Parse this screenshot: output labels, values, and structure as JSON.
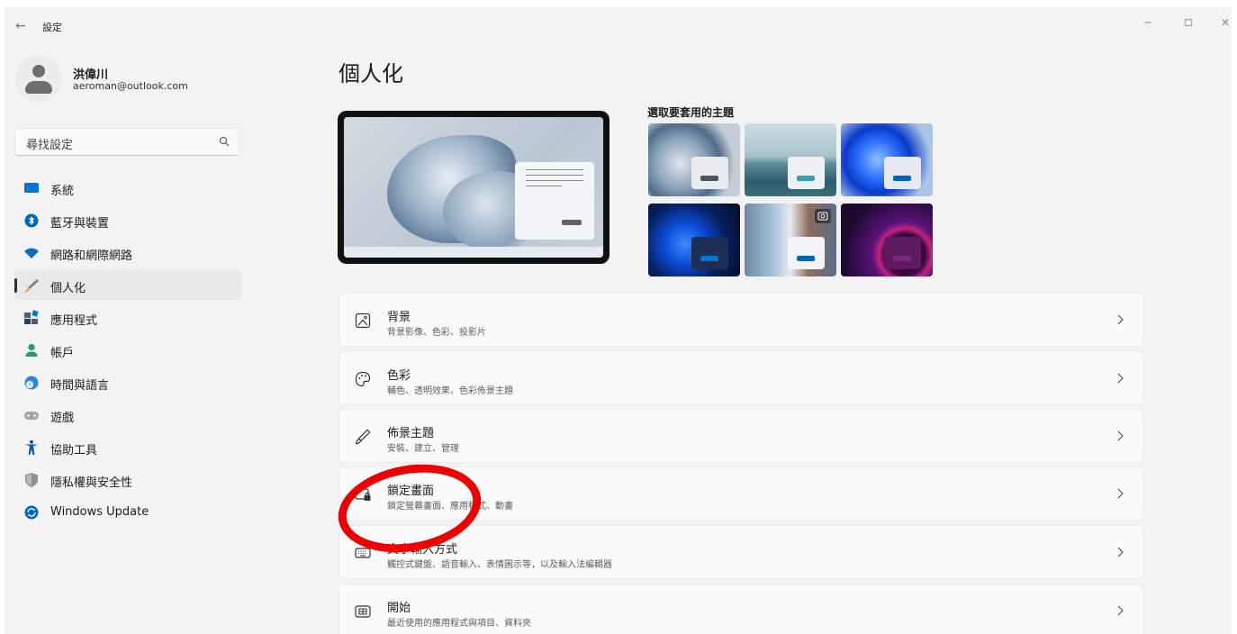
{
  "window": {
    "title": "設定",
    "back": "←",
    "minimize": "─",
    "close": "✕"
  },
  "user": {
    "name": "洪偉川",
    "email": "aeroman@outlook.com"
  },
  "search": {
    "placeholder": "尋找設定"
  },
  "nav": [
    {
      "label": "系統",
      "icon": "monitor-icon",
      "color": "#0078d4"
    },
    {
      "label": "藍牙與裝置",
      "icon": "bluetooth-icon",
      "color": "#0067c0"
    },
    {
      "label": "網路和網際網路",
      "icon": "wifi-icon",
      "color": "#0f6cbd"
    },
    {
      "label": "個人化",
      "icon": "brush-icon",
      "color": "#e8a33d",
      "active": true
    },
    {
      "label": "應用程式",
      "icon": "apps-icon",
      "color": "#4a5e75"
    },
    {
      "label": "帳戶",
      "icon": "person-icon",
      "color": "#1f9e6f"
    },
    {
      "label": "時間與語言",
      "icon": "globe-clock-icon",
      "color": "#2b88d8"
    },
    {
      "label": "遊戲",
      "icon": "gamepad-icon",
      "color": "#7a8a9a"
    },
    {
      "label": "協助工具",
      "icon": "accessibility-icon",
      "color": "#0b5cad"
    },
    {
      "label": "隱私權與安全性",
      "icon": "shield-icon",
      "color": "#8a8f98"
    },
    {
      "label": "Windows Update",
      "icon": "update-icon",
      "color": "#0067c0"
    }
  ],
  "main": {
    "title": "個人化",
    "themes_label": "選取要套用的主題",
    "themes": [
      {
        "icon": "theme-bloom-light",
        "window_color": "#e8ebef",
        "button_color": "#4d5560"
      },
      {
        "icon": "theme-lake",
        "window_color": "#eef1f2",
        "button_color": "#3a9bb8"
      },
      {
        "icon": "theme-bloom-blue",
        "window_color": "#e6eaf0",
        "button_color": "#0063c6"
      },
      {
        "icon": "theme-bloom-dark",
        "window_color": "#1e2f55",
        "button_color": "#0078d4"
      },
      {
        "icon": "theme-spotlight",
        "window_color": "#f2f4f6",
        "button_color": "#0067c0"
      },
      {
        "icon": "theme-glow",
        "window_color": "#5d1a5f",
        "button_color": "#7a2a7c"
      }
    ],
    "cards": [
      {
        "title": "背景",
        "desc": "背景影像、色彩、投影片",
        "icon": "image-icon"
      },
      {
        "title": "色彩",
        "desc": "輔色、透明效果、色彩佈景主題",
        "icon": "palette-icon"
      },
      {
        "title": "佈景主題",
        "desc": "安裝、建立、管理",
        "icon": "pen-icon"
      },
      {
        "title": "鎖定畫面",
        "desc": "鎖定螢幕畫面、應用程式、動畫",
        "icon": "lock-screen-icon"
      },
      {
        "title": "文字輸入方式",
        "desc": "觸控式鍵盤、語音輸入、表情圖示等，以及輸入法編輯器",
        "icon": "keyboard-icon"
      },
      {
        "title": "開始",
        "desc": "最近使用的應用程式與項目、資料夾",
        "icon": "start-icon"
      }
    ]
  }
}
